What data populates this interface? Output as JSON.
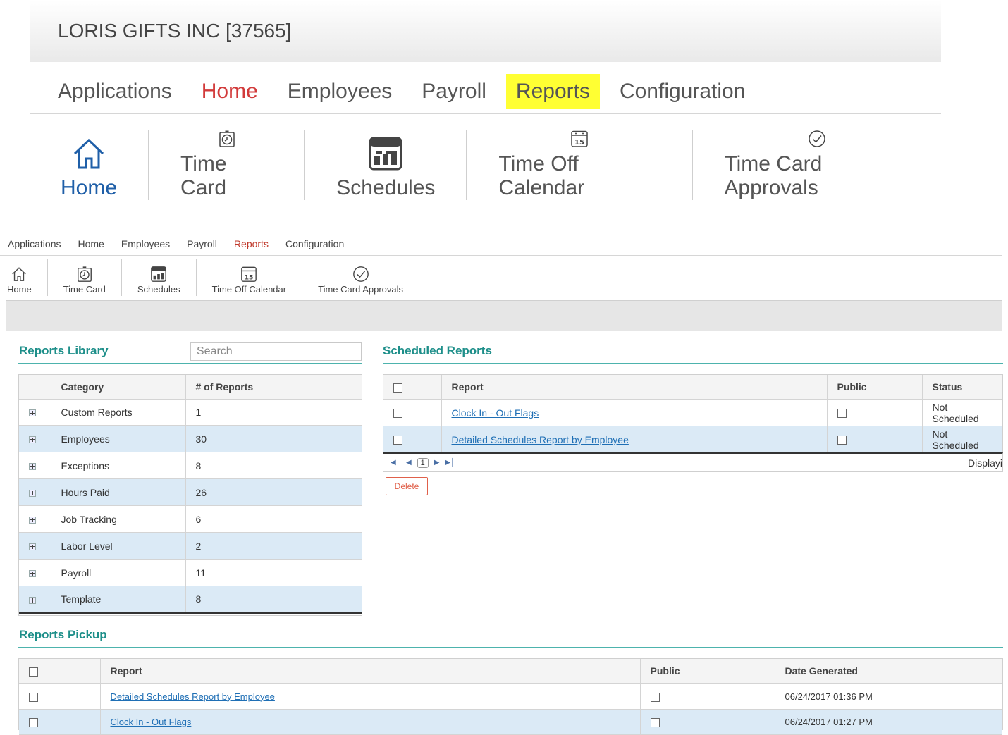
{
  "company": "LORIS GIFTS INC [37565]",
  "nav": [
    "Applications",
    "Home",
    "Employees",
    "Payroll",
    "Reports",
    "Configuration"
  ],
  "tools": [
    {
      "label": "Home",
      "icon": "home-icon"
    },
    {
      "label": "Time Card",
      "icon": "stopwatch-icon"
    },
    {
      "label": "Schedules",
      "icon": "schedule-icon"
    },
    {
      "label": "Time Off Calendar",
      "icon": "calendar-icon"
    },
    {
      "label": "Time Card Approvals",
      "icon": "checkmark-circle-icon"
    }
  ],
  "calendar_day": "15",
  "library": {
    "title": "Reports Library",
    "search_placeholder": "Search",
    "headers": [
      "Category",
      "# of Reports"
    ],
    "rows": [
      {
        "category": "Custom Reports",
        "count": "1"
      },
      {
        "category": "Employees",
        "count": "30"
      },
      {
        "category": "Exceptions",
        "count": "8"
      },
      {
        "category": "Hours Paid",
        "count": "26"
      },
      {
        "category": "Job Tracking",
        "count": "6"
      },
      {
        "category": "Labor Level",
        "count": "2"
      },
      {
        "category": "Payroll",
        "count": "11"
      },
      {
        "category": "Template",
        "count": "8"
      }
    ]
  },
  "scheduled": {
    "title": "Scheduled Reports",
    "headers": [
      "Report",
      "Public",
      "Status"
    ],
    "rows": [
      {
        "report": "Clock In - Out Flags",
        "status": "Not Scheduled"
      },
      {
        "report": "Detailed Schedules Report by Employee",
        "status": "Not Scheduled"
      }
    ],
    "page": "1",
    "display_text": "Displayi",
    "delete_label": "Delete"
  },
  "pickup": {
    "title": "Reports Pickup",
    "headers": [
      "Report",
      "Public",
      "Date Generated"
    ],
    "rows": [
      {
        "report": "Detailed Schedules Report by Employee",
        "date": "06/24/2017 01:36 PM"
      },
      {
        "report": "Clock In - Out Flags",
        "date": "06/24/2017 01:27 PM"
      }
    ]
  },
  "colors": {
    "accent_teal": "#1e8f8a",
    "home_red": "#d23a3a",
    "reports_highlight": "#ffff33",
    "link_blue": "#1f6fb5",
    "row_alt": "#dbeaf6",
    "delete_red": "#e0604a"
  }
}
